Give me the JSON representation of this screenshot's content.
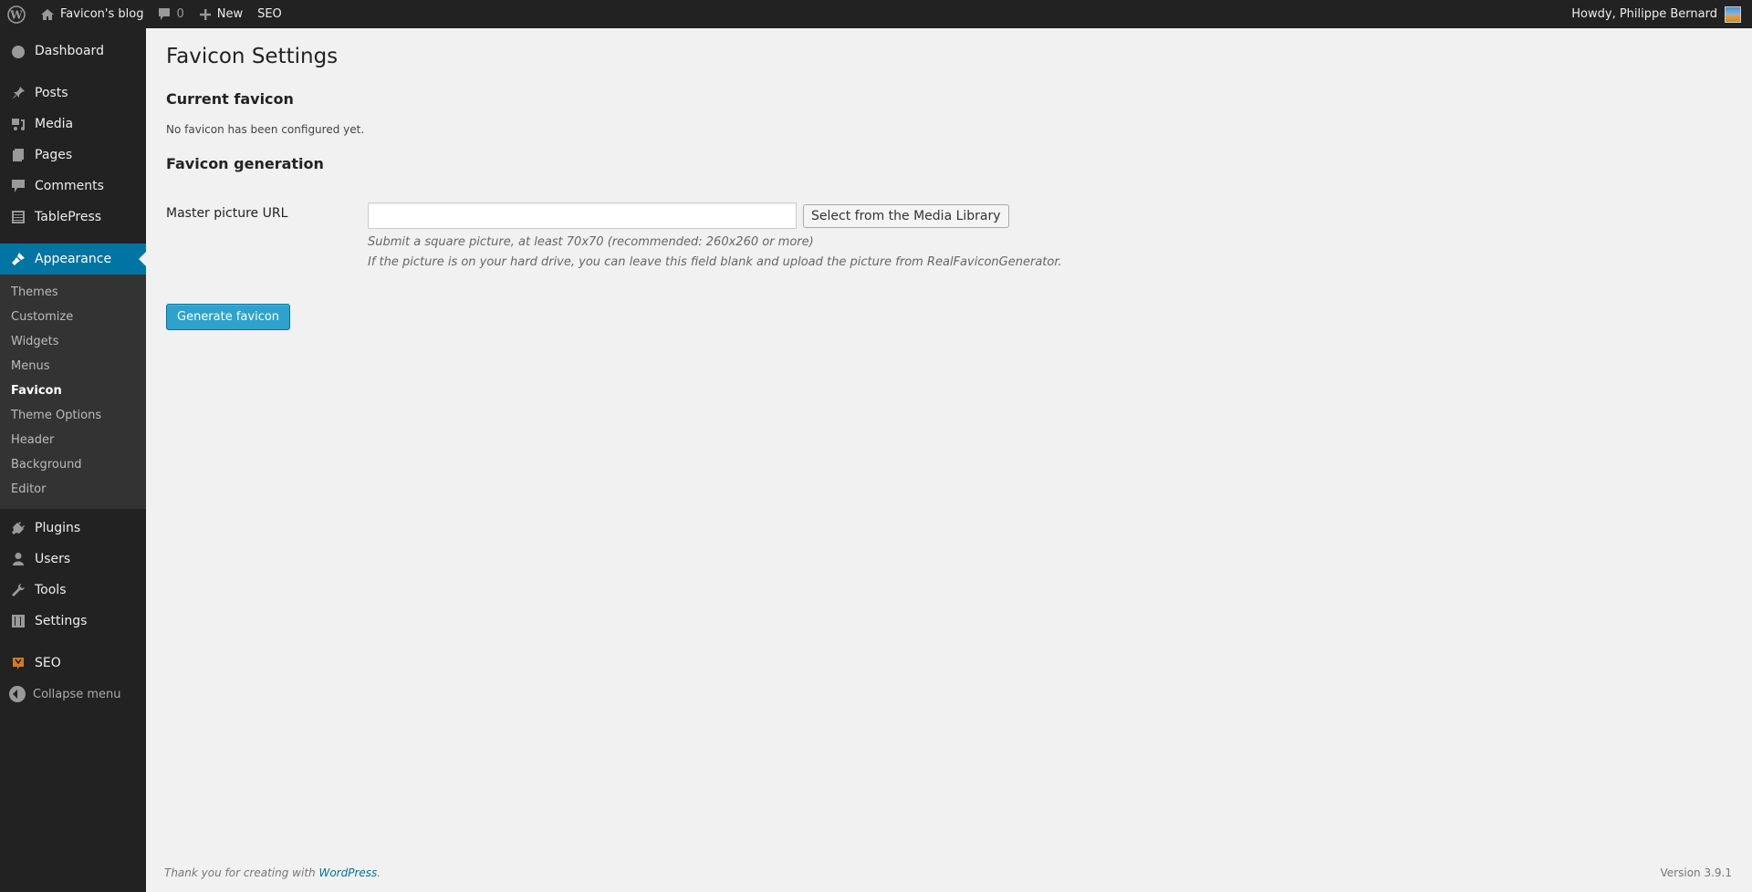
{
  "adminbar": {
    "site_name": "Favicon's blog",
    "comments_count": "0",
    "new_label": "New",
    "seo_label": "SEO",
    "greeting": "Howdy, Philippe Bernard"
  },
  "sidebar": {
    "items_top": [
      {
        "label": "Dashboard",
        "icon": "dashboard-icon"
      },
      {
        "label": "Posts",
        "icon": "pin-icon"
      },
      {
        "label": "Media",
        "icon": "media-icon"
      },
      {
        "label": "Pages",
        "icon": "pages-icon"
      },
      {
        "label": "Comments",
        "icon": "comment-icon"
      },
      {
        "label": "TablePress",
        "icon": "table-icon"
      }
    ],
    "current": {
      "label": "Appearance",
      "icon": "paintbrush-icon"
    },
    "submenu": [
      "Themes",
      "Customize",
      "Widgets",
      "Menus",
      "Favicon",
      "Theme Options",
      "Header",
      "Background",
      "Editor"
    ],
    "submenu_current": "Favicon",
    "items_bottom": [
      {
        "label": "Plugins",
        "icon": "plug-icon"
      },
      {
        "label": "Users",
        "icon": "user-icon"
      },
      {
        "label": "Tools",
        "icon": "wrench-icon"
      },
      {
        "label": "Settings",
        "icon": "settings-icon"
      }
    ],
    "seo": {
      "label": "SEO",
      "icon": "yoast-icon",
      "color": "#d27d1f"
    },
    "collapse_label": "Collapse menu"
  },
  "main": {
    "title": "Favicon Settings",
    "current_heading": "Current favicon",
    "current_desc": "No favicon has been configured yet.",
    "generation_heading": "Favicon generation",
    "field_label": "Master picture URL",
    "field_value": "",
    "media_button": "Select from the Media Library",
    "hint1": "Submit a square picture, at least 70x70 (recommended: 260x260 or more)",
    "hint2": "If the picture is on your hard drive, you can leave this field blank and upload the picture from RealFaviconGenerator.",
    "generate_button": "Generate favicon"
  },
  "footer": {
    "thanks_prefix": "Thank you for creating with ",
    "thanks_link": "WordPress",
    "thanks_suffix": ".",
    "version": "Version 3.9.1"
  },
  "colors": {
    "accent": "#0074a2",
    "button_primary": "#2ea2cc",
    "sidebar_bg": "#222222",
    "submenu_bg": "#333333"
  }
}
